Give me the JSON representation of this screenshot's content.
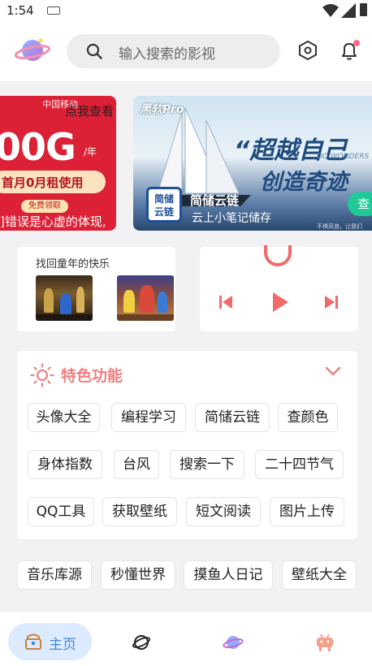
{
  "status_bar": {
    "time": "1:54"
  },
  "header": {
    "search_placeholder": "输入搜索的影视"
  },
  "banners": [
    {
      "carrier": "中国移动",
      "link": "点我查看",
      "headline": "00G",
      "unit": "/年",
      "ribbon": "首月0月租使用",
      "button": "免费领取",
      "note": "]错误是心虚的体现,"
    },
    {
      "brand": "黑软Pro",
      "slogan_top": "“超越自己",
      "slogan_sub": "DO WONDERS",
      "slogan_bottom": "创造奇迹",
      "app_icon_text": "简储云链",
      "app_name": "简储云链",
      "app_tagline": "云上小笔记储存",
      "check_label": "查",
      "fine_print": "不惧风浪，让我们"
    }
  ],
  "games_card": {
    "title": "找回童年的快乐"
  },
  "features": {
    "title": "特色功能",
    "rows": [
      [
        "头像大全",
        "编程学习",
        "简储云链",
        "查颜色"
      ],
      [
        "身体指数",
        "台风",
        "搜索一下",
        "二十四节气"
      ],
      [
        "QQ工具",
        "获取壁纸",
        "短文阅读",
        "图片上传"
      ]
    ]
  },
  "quick_links": [
    "音乐库源",
    "秒懂世界",
    "摸鱼人日记",
    "壁纸大全"
  ],
  "bottom_nav": {
    "home_label": "主页"
  },
  "colors": {
    "accent_blue": "#4a84d8",
    "feature_title": "#f08080",
    "music_red": "#f26a6a",
    "banner_red": "#dc2035"
  }
}
